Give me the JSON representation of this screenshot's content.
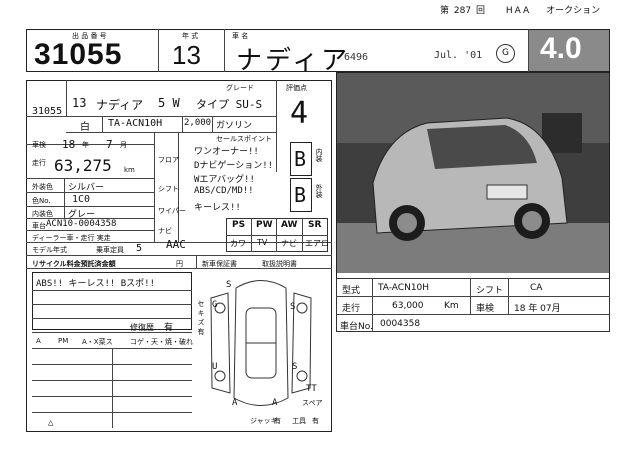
{
  "header": {
    "sheet_prefix": "第",
    "sheet_number": "287",
    "sheet_suffix": "回",
    "auction": "HAA",
    "auction_label": "オークション"
  },
  "top": {
    "lot_label": "出 品 番 号",
    "lot_number": "31055",
    "year_label": "年 式",
    "year": "13",
    "model_label": "車 名",
    "model": "ナディア",
    "code_note": "6496",
    "date_note": "Jul. '01",
    "grade_score": "4.0"
  },
  "sheet": {
    "lot_small": "31055",
    "year_small": "13",
    "model_small": "ナディア",
    "body_type": "5 W",
    "type_grade": "タイプ SU-S",
    "grade_label": "グレード",
    "score_label": "評価点",
    "score_hand": "4",
    "color_short": "白",
    "chassis_type": "TA-ACN10H",
    "displacement": "2,000",
    "fuel": "ガソリン",
    "sales_point_label": "セールスポイント",
    "inspection_label": "車検",
    "inspection_year": "18",
    "inspection_year_unit": "年",
    "inspection_month": "7",
    "inspection_month_unit": "月",
    "mileage_label": "走行",
    "mileage": "63,275",
    "mileage_unit": "km",
    "ext_color_label": "外装色",
    "ext_color": "シルバー",
    "color_no_label": "色No.",
    "color_no": "1C0",
    "int_color_label": "内装色",
    "int_color": "グレー",
    "frame_label": "車台",
    "frame_no": "ACN10-0004358",
    "dealer_label": "ディーラー車・走行 実走",
    "model_year_label": "モデル年式",
    "capacity_label": "乗車定員",
    "capacity": "5",
    "aac": "AAC",
    "recycle_label": "リサイクル料金預託済金額",
    "recycle_unit": "円",
    "new_car_warranty": "新車保証書",
    "manual": "取扱説明書",
    "eq_labels": [
      "PS",
      "PW",
      "AW",
      "SR",
      "カワ",
      "TV",
      "ナビ",
      "エアロ"
    ],
    "photo_labels": [
      "フロア",
      "シフト",
      "ワイパー",
      "ナビ"
    ],
    "sales_points": [
      "ワンオーナー!!",
      "Dナビゲーション!!",
      "Wエアバッグ!!",
      "ABS/CD/MD!!",
      "キーレス!!"
    ],
    "rating_labels": [
      "内装",
      "外装"
    ],
    "rating_values": [
      "B",
      "B"
    ],
    "equipment_line": "ABS!! キーレス!! Bスポ!!",
    "repair_label": "修復歴",
    "repair_value": "有",
    "opt_labels": [
      "A",
      "PM",
      "A・X菜ス",
      "コゲ・天・焼・破れ"
    ],
    "side_text": "セ キ ズ 有",
    "damage_marks": [
      "S",
      "S",
      "G",
      "U",
      "S",
      "A",
      "A",
      "TT",
      "スペア"
    ],
    "footer_labels": [
      "ジャッキ",
      "有",
      "工具",
      "有"
    ],
    "footer_marks": [
      "△"
    ]
  },
  "photo_panel": {
    "spec_table": [
      {
        "label": "型式",
        "value": "TA-ACN10H",
        "label2": "シフト",
        "value2": "CA"
      },
      {
        "label": "走行",
        "value": "63,000",
        "unit": "Km",
        "label2": "車検",
        "value2": "18 年 07月"
      },
      {
        "label": "車台No.",
        "value": "0004358"
      }
    ]
  }
}
